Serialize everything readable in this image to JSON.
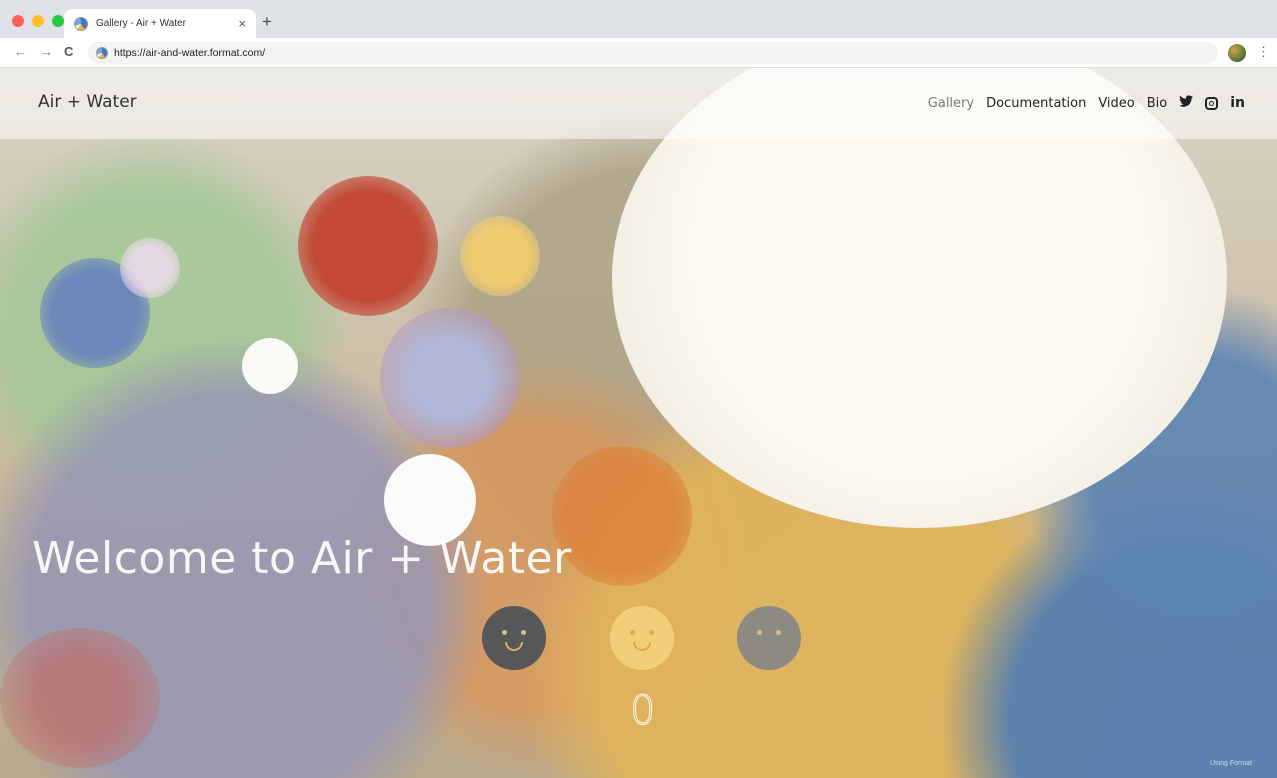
{
  "browser": {
    "tab_title": "Gallery - Air + Water",
    "tab_close": "×",
    "new_tab": "+",
    "back": "←",
    "forward": "→",
    "reload": "C",
    "url": "https://air-and-water.format.com/",
    "menu": "⋮",
    "colors": {
      "close": "#ff5f57",
      "minimize": "#febc2e",
      "maximize": "#28c840"
    }
  },
  "site": {
    "logo": "Air + Water",
    "nav": [
      {
        "label": "Gallery",
        "active": true
      },
      {
        "label": "Documentation",
        "active": false
      },
      {
        "label": "Video",
        "active": false
      },
      {
        "label": "Bio",
        "active": false
      }
    ],
    "social": {
      "twitter": "🐦",
      "instagram": "instagram-icon",
      "linkedin": "in"
    },
    "hero_title": "Welcome to Air + Water",
    "counter": "0",
    "credit": "Using Format"
  }
}
